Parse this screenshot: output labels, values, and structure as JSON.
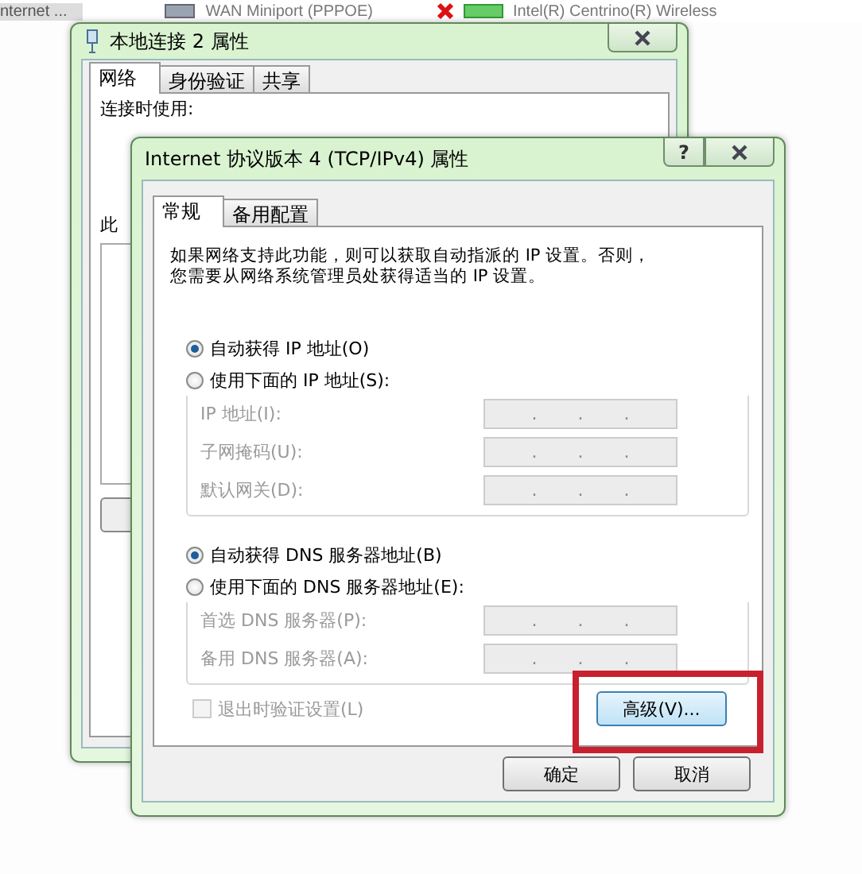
{
  "taskbar": {
    "items": [
      {
        "label": "nternet ...",
        "kind": "none",
        "disconnected": false
      },
      {
        "label": "WAN Miniport (PPPOE)",
        "kind": "modem",
        "disconnected": false
      },
      {
        "label": "Intel(R) Centrino(R) Wireless",
        "kind": "wireless",
        "disconnected": true
      }
    ]
  },
  "back_window": {
    "title": "本地连接 2 属性",
    "tabs": [
      {
        "label": "网络",
        "selected": true
      },
      {
        "label": "身份验证",
        "selected": false
      },
      {
        "label": "共享",
        "selected": false
      }
    ],
    "connect_label": "连接时使用:",
    "cut_label": "此"
  },
  "dialog": {
    "title": "Internet 协议版本 4 (TCP/IPv4) 属性",
    "help": "?",
    "tabs": [
      {
        "label": "常规",
        "selected": true
      },
      {
        "label": "备用配置",
        "selected": false
      }
    ],
    "intro": [
      "如果网络支持此功能，则可以获取自动指派的 IP 设置。否则，",
      "您需要从网络系统管理员处获得适当的 IP 设置。"
    ],
    "groups": [
      {
        "auto": {
          "label": "自动获得 IP 地址(O)",
          "selected": true
        },
        "manual": {
          "label": "使用下面的 IP 地址(S):",
          "selected": false
        },
        "fields": [
          {
            "label": "IP 地址(I):",
            "value": ". . .",
            "disabled": true
          },
          {
            "label": "子网掩码(U):",
            "value": ". . .",
            "disabled": true
          },
          {
            "label": "默认网关(D):",
            "value": ". . .",
            "disabled": true
          }
        ]
      },
      {
        "auto": {
          "label": "自动获得 DNS 服务器地址(B)",
          "selected": true
        },
        "manual": {
          "label": "使用下面的 DNS 服务器地址(E):",
          "selected": false
        },
        "fields": [
          {
            "label": "首选 DNS 服务器(P):",
            "value": ". . .",
            "disabled": true
          },
          {
            "label": "备用 DNS 服务器(A):",
            "value": ". . .",
            "disabled": true
          }
        ]
      }
    ],
    "validate": {
      "label": "退出时验证设置(L)",
      "checked": false,
      "disabled": true
    },
    "advanced": {
      "label": "高级(V)...",
      "hovered": true
    },
    "buttons": [
      "确定",
      "取消"
    ]
  }
}
